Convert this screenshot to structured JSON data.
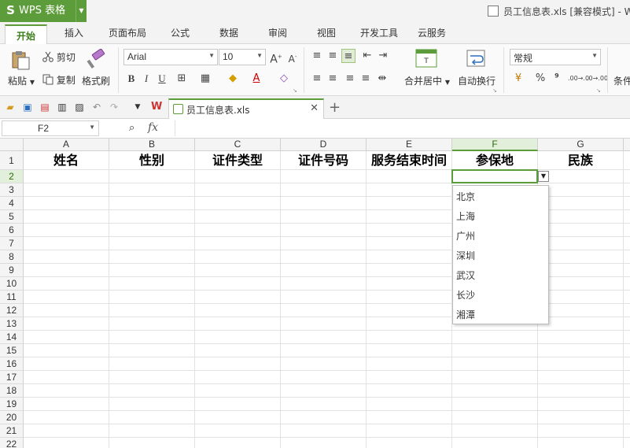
{
  "app": {
    "name": "WPS 表格",
    "logo": "S"
  },
  "window": {
    "title": "员工信息表.xls [兼容模式] - W"
  },
  "menu_tabs": [
    "开始",
    "插入",
    "页面布局",
    "公式",
    "数据",
    "审阅",
    "视图",
    "开发工具",
    "云服务"
  ],
  "ribbon": {
    "paste": "粘贴",
    "cut": "剪切",
    "copy": "复制",
    "format_painter": "格式刷",
    "font_name": "Arial",
    "font_size": "10",
    "merge_center": "合并居中",
    "wrap_text": "自动换行",
    "number_format": "常规",
    "percent": "%",
    "comma": "⁹",
    "dec_inc": ".00→.0",
    "dec_dec": ".0→.00",
    "cond_format_partial": "条件"
  },
  "doc_tab": {
    "label": "员工信息表.xls"
  },
  "formula_bar": {
    "name_box": "F2",
    "fx_label": "fx",
    "content": ""
  },
  "columns": [
    "A",
    "B",
    "C",
    "D",
    "E",
    "F",
    "G"
  ],
  "rows": [
    "1",
    "2",
    "3",
    "4",
    "5",
    "6",
    "7",
    "8",
    "9",
    "10",
    "11",
    "12",
    "13",
    "14",
    "15",
    "16",
    "17",
    "18",
    "19",
    "20",
    "21",
    "22"
  ],
  "headers": [
    "姓名",
    "性别",
    "证件类型",
    "证件号码",
    "服务结束时间",
    "参保地",
    "民族"
  ],
  "selected_cell": "F2",
  "dropdown_options": [
    "北京",
    "上海",
    "广州",
    "深圳",
    "武汉",
    "长沙",
    "湘潭"
  ],
  "colors": {
    "accent": "#5d9c3a",
    "tab_text": "#3e7d1e"
  }
}
